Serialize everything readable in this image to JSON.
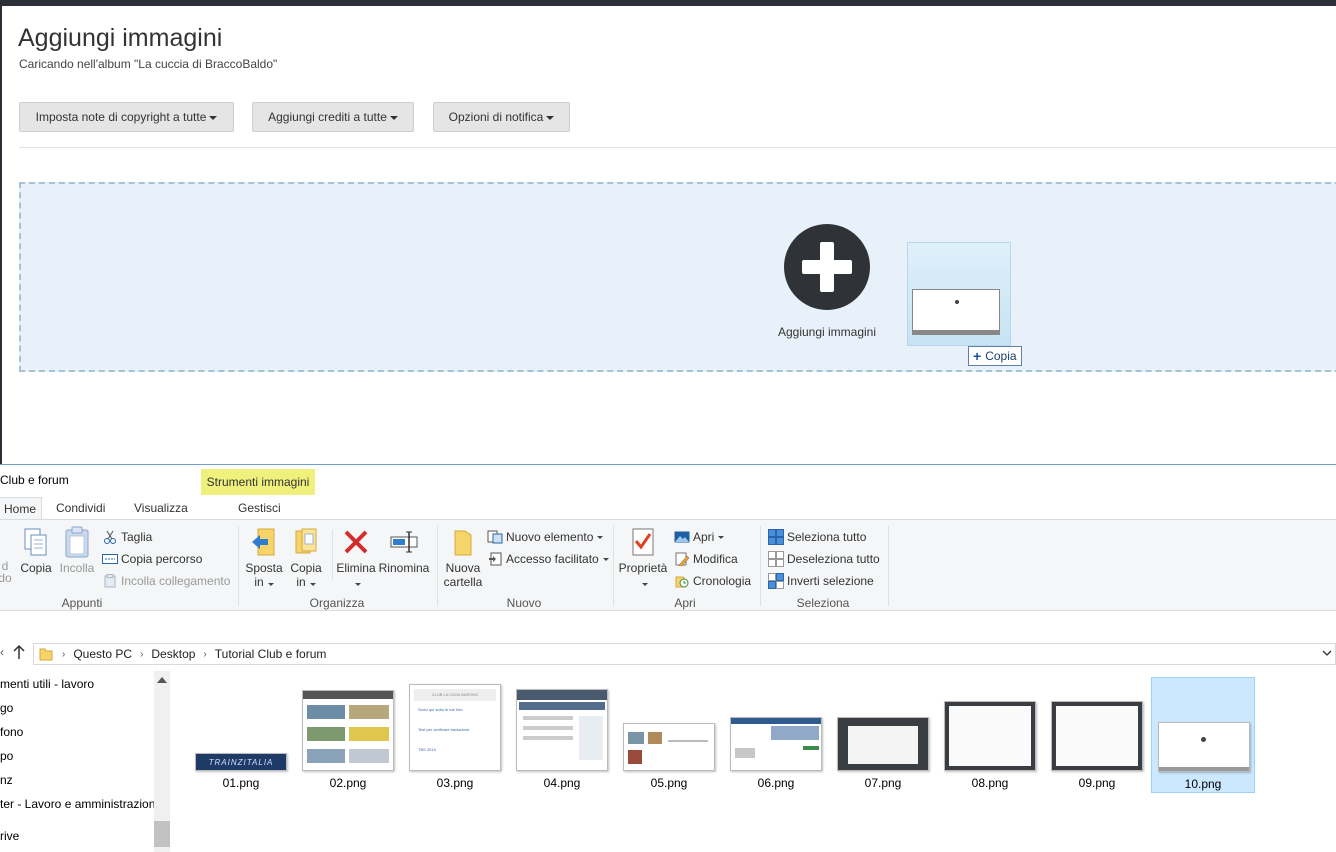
{
  "web": {
    "title": "Aggiungi immagini",
    "subtitle": "Caricando nell'album \"La cuccia di BraccoBaldo\"",
    "buttons": [
      {
        "label": "Imposta note di copyright a tutte"
      },
      {
        "label": "Aggiungi crediti a tutte"
      },
      {
        "label": "Opzioni di notifica"
      }
    ],
    "dropzone": {
      "add_label": "Aggiungi immagini",
      "drag_tooltip": "Copia",
      "drag_tooltip_icon": "+"
    }
  },
  "explorer": {
    "window_title": "Club e forum",
    "contextual_tab": "Strumenti immagini",
    "tabs": [
      "Home",
      "Condividi",
      "Visualizza",
      "Gestisci"
    ],
    "ribbon": {
      "appunti": {
        "label": "Appunti",
        "partial_text_1": "d",
        "partial_text_2": "do",
        "copia": "Copia",
        "incolla": "Incolla",
        "taglia": "Taglia",
        "copia_percorso": "Copia percorso",
        "incolla_collegamento": "Incolla collegamento"
      },
      "organizza": {
        "label": "Organizza",
        "sposta_1": "Sposta",
        "sposta_2": "in",
        "copia_1": "Copia",
        "copia_2": "in",
        "elimina": "Elimina",
        "rinomina": "Rinomina"
      },
      "nuovo": {
        "label": "Nuovo",
        "nuova_cartella_1": "Nuova",
        "nuova_cartella_2": "cartella",
        "nuovo_elemento": "Nuovo elemento",
        "accesso_facilitato": "Accesso facilitato"
      },
      "apri": {
        "label": "Apri",
        "proprieta": "Proprietà",
        "apri": "Apri",
        "modifica": "Modifica",
        "cronologia": "Cronologia"
      },
      "seleziona": {
        "label": "Seleziona",
        "seleziona_tutto": "Seleziona tutto",
        "deseleziona_tutto": "Deseleziona tutto",
        "inverti_selezione": "Inverti selezione"
      }
    },
    "breadcrumb": [
      "Questo PC",
      "Desktop",
      "Tutorial Club e forum"
    ],
    "nav_items": [
      "menti utili - lavoro",
      "go",
      "fono",
      "po",
      "nz",
      "ter - Lavoro e amministrazion",
      "rive"
    ],
    "files": [
      {
        "name": "01.png"
      },
      {
        "name": "02.png"
      },
      {
        "name": "03.png"
      },
      {
        "name": "04.png"
      },
      {
        "name": "05.png"
      },
      {
        "name": "06.png"
      },
      {
        "name": "07.png"
      },
      {
        "name": "08.png"
      },
      {
        "name": "09.png"
      },
      {
        "name": "10.png",
        "selected": true
      }
    ],
    "thumb_text": {
      "file01_logo": "TRAINZITALIA",
      "file03_header": "CLUB LA CASA BAROKO",
      "file03_item1": "Scrivi qui sotto le tue foto",
      "file03_item2": "Test per verificare traduzione",
      "file03_item3": "TBS 2019"
    }
  },
  "colors": {
    "dropzone_bg": "#e8f1f9",
    "dropzone_border": "#a7c3d3",
    "add_circle": "#2f3338",
    "contextual_tab": "#f0f07c",
    "selected_file": "#cce8ff"
  }
}
